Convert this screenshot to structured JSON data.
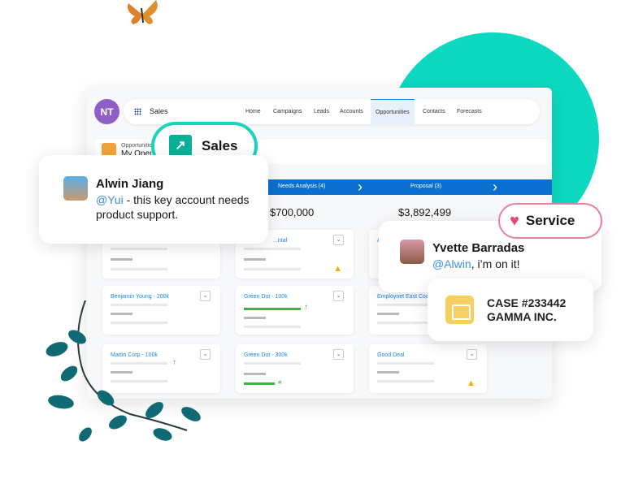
{
  "app": {
    "avatar_initials": "NT",
    "name": "Sales"
  },
  "nav": {
    "tabs": [
      "Home",
      "Campaigns",
      "Leads",
      "Accounts",
      "Opportunities",
      "Contacts",
      "Forecasts"
    ],
    "active": "Opportunities"
  },
  "header": {
    "object_label": "Opportunities",
    "list_title": "My Open"
  },
  "pipeline": {
    "stages": [
      {
        "label": "Needs Analysis (4)",
        "amount": "$700,000"
      },
      {
        "label": "Proposal (3)",
        "amount": "$3,892,499"
      }
    ]
  },
  "cards": {
    "col1": [
      {
        "title": ""
      },
      {
        "title": "Benjamin Young  - 200k"
      },
      {
        "title": "Martin Corp - 100k"
      }
    ],
    "col2": [
      {
        "title": "...ntal"
      },
      {
        "title": "Green Dot - 100k"
      },
      {
        "title": "Green Dot - 300k"
      }
    ],
    "col3": [
      {
        "title": "A"
      },
      {
        "title": "Employnet East Coa"
      },
      {
        "title": "Good Deal"
      }
    ]
  },
  "sales_badge": {
    "label": "Sales",
    "icon": "trending-chart-icon"
  },
  "chat1": {
    "name": "Alwin Jiang",
    "mention": "@Yui",
    "text": " - this key account needs product support."
  },
  "service_badge": {
    "label": "Service",
    "icon": "heart-icon"
  },
  "chat2": {
    "name": "Yvette Barradas",
    "mention": "@Alwin",
    "text": ", i’m on it!"
  },
  "case": {
    "line1": "CASE #233442",
    "line2": "GAMMA INC.",
    "icon": "briefcase-icon"
  },
  "colors": {
    "teal": "#0dd9c0",
    "stage_blue": "#0b6fd0",
    "link": "#1589ee",
    "service_pink": "#e8829a"
  }
}
